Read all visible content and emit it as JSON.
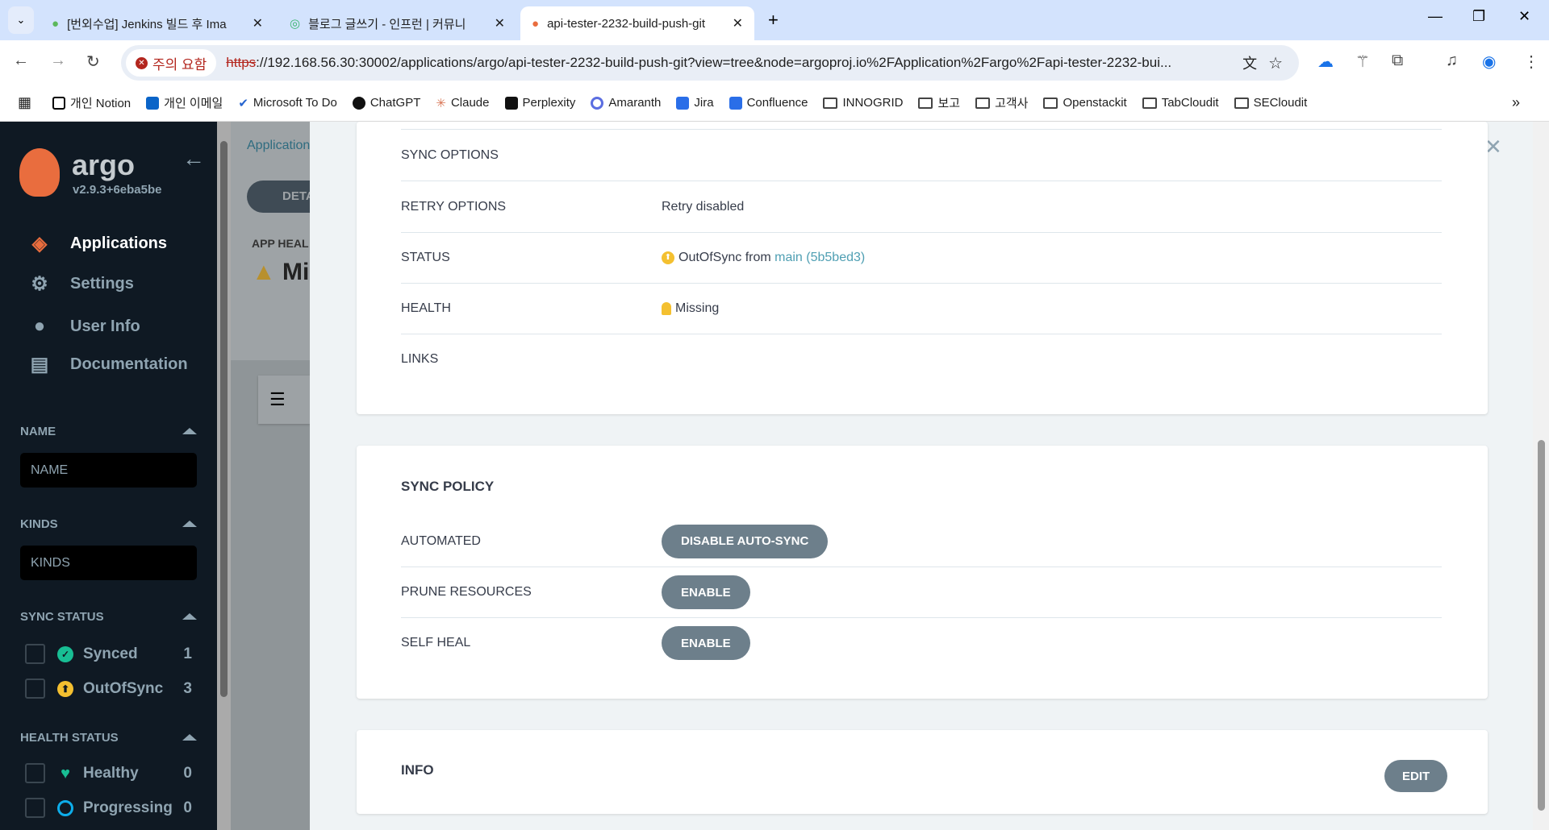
{
  "browser": {
    "tabs": [
      {
        "title": "[번외수업] Jenkins 빌드 후 Ima",
        "icon": "jenkins-icon"
      },
      {
        "title": "블로그 글쓰기 - 인프런 | 커뮤니",
        "icon": "inflearn-icon"
      },
      {
        "title": "api-tester-2232-build-push-git",
        "icon": "argo-icon",
        "active": true
      }
    ],
    "security_warning": "주의 요함",
    "url_scheme": "https",
    "url_rest": "://192.168.56.30:30002/applications/argo/api-tester-2232-build-push-git?view=tree&node=argoproj.io%2FApplication%2Fargo%2Fapi-tester-2232-bui...",
    "bookmarks": [
      {
        "label": "개인 Notion",
        "icon": "notion-icon"
      },
      {
        "label": "개인 이메일",
        "icon": "outlook-icon"
      },
      {
        "label": "Microsoft To Do",
        "icon": "todo-icon"
      },
      {
        "label": "ChatGPT",
        "icon": "chatgpt-icon"
      },
      {
        "label": "Claude",
        "icon": "claude-icon"
      },
      {
        "label": "Perplexity",
        "icon": "perplexity-icon"
      },
      {
        "label": "Amaranth",
        "icon": "amaranth-icon"
      },
      {
        "label": "Jira",
        "icon": "jira-icon"
      },
      {
        "label": "Confluence",
        "icon": "confluence-icon"
      },
      {
        "label": "INNOGRID",
        "icon": "folder-icon"
      },
      {
        "label": "보고",
        "icon": "folder-icon"
      },
      {
        "label": "고객사",
        "icon": "folder-icon"
      },
      {
        "label": "Openstackit",
        "icon": "folder-icon"
      },
      {
        "label": "TabCloudit",
        "icon": "folder-icon"
      },
      {
        "label": "SECloudit",
        "icon": "folder-icon"
      }
    ]
  },
  "sidebar": {
    "brand": "argo",
    "version": "v2.9.3+6eba5be",
    "nav": [
      {
        "label": "Applications",
        "icon": "layers-icon"
      },
      {
        "label": "Settings",
        "icon": "gear-icon"
      },
      {
        "label": "User Info",
        "icon": "user-icon"
      },
      {
        "label": "Documentation",
        "icon": "book-icon"
      }
    ],
    "filters": {
      "name": {
        "title": "NAME",
        "placeholder": "NAME"
      },
      "kinds": {
        "title": "KINDS",
        "placeholder": "KINDS"
      },
      "sync_status": {
        "title": "SYNC STATUS",
        "items": [
          {
            "label": "Synced",
            "count": "1",
            "color": "#18be94"
          },
          {
            "label": "OutOfSync",
            "count": "3",
            "color": "#f4c030"
          }
        ]
      },
      "health_status": {
        "title": "HEALTH STATUS",
        "items": [
          {
            "label": "Healthy",
            "count": "0",
            "color": "#18be94"
          },
          {
            "label": "Progressing",
            "count": "0",
            "color": "#0dadea"
          }
        ]
      }
    }
  },
  "background": {
    "breadcrumb": "Application",
    "details_button": "DETA",
    "app_health_label": "APP HEAL",
    "app_health_value": "Mis"
  },
  "details": {
    "rows": [
      {
        "label": "SYNC OPTIONS",
        "value": ""
      },
      {
        "label": "RETRY OPTIONS",
        "value": "Retry disabled"
      },
      {
        "label": "STATUS",
        "value": "OutOfSync from ",
        "link": "main (5b5bed3)"
      },
      {
        "label": "HEALTH",
        "value": "Missing"
      },
      {
        "label": "LINKS",
        "value": ""
      }
    ],
    "sync_policy": {
      "title": "SYNC POLICY",
      "rows": [
        {
          "label": "AUTOMATED",
          "button": "DISABLE AUTO-SYNC"
        },
        {
          "label": "PRUNE RESOURCES",
          "button": "ENABLE"
        },
        {
          "label": "SELF HEAL",
          "button": "ENABLE"
        }
      ]
    },
    "info": {
      "title": "INFO",
      "edit": "EDIT"
    }
  },
  "colors": {
    "sidebar": "#0f1923",
    "button": "#6d7f8b",
    "link": "#4f9fb3",
    "outofsync": "#f4c030",
    "missing": "#f4c030"
  }
}
